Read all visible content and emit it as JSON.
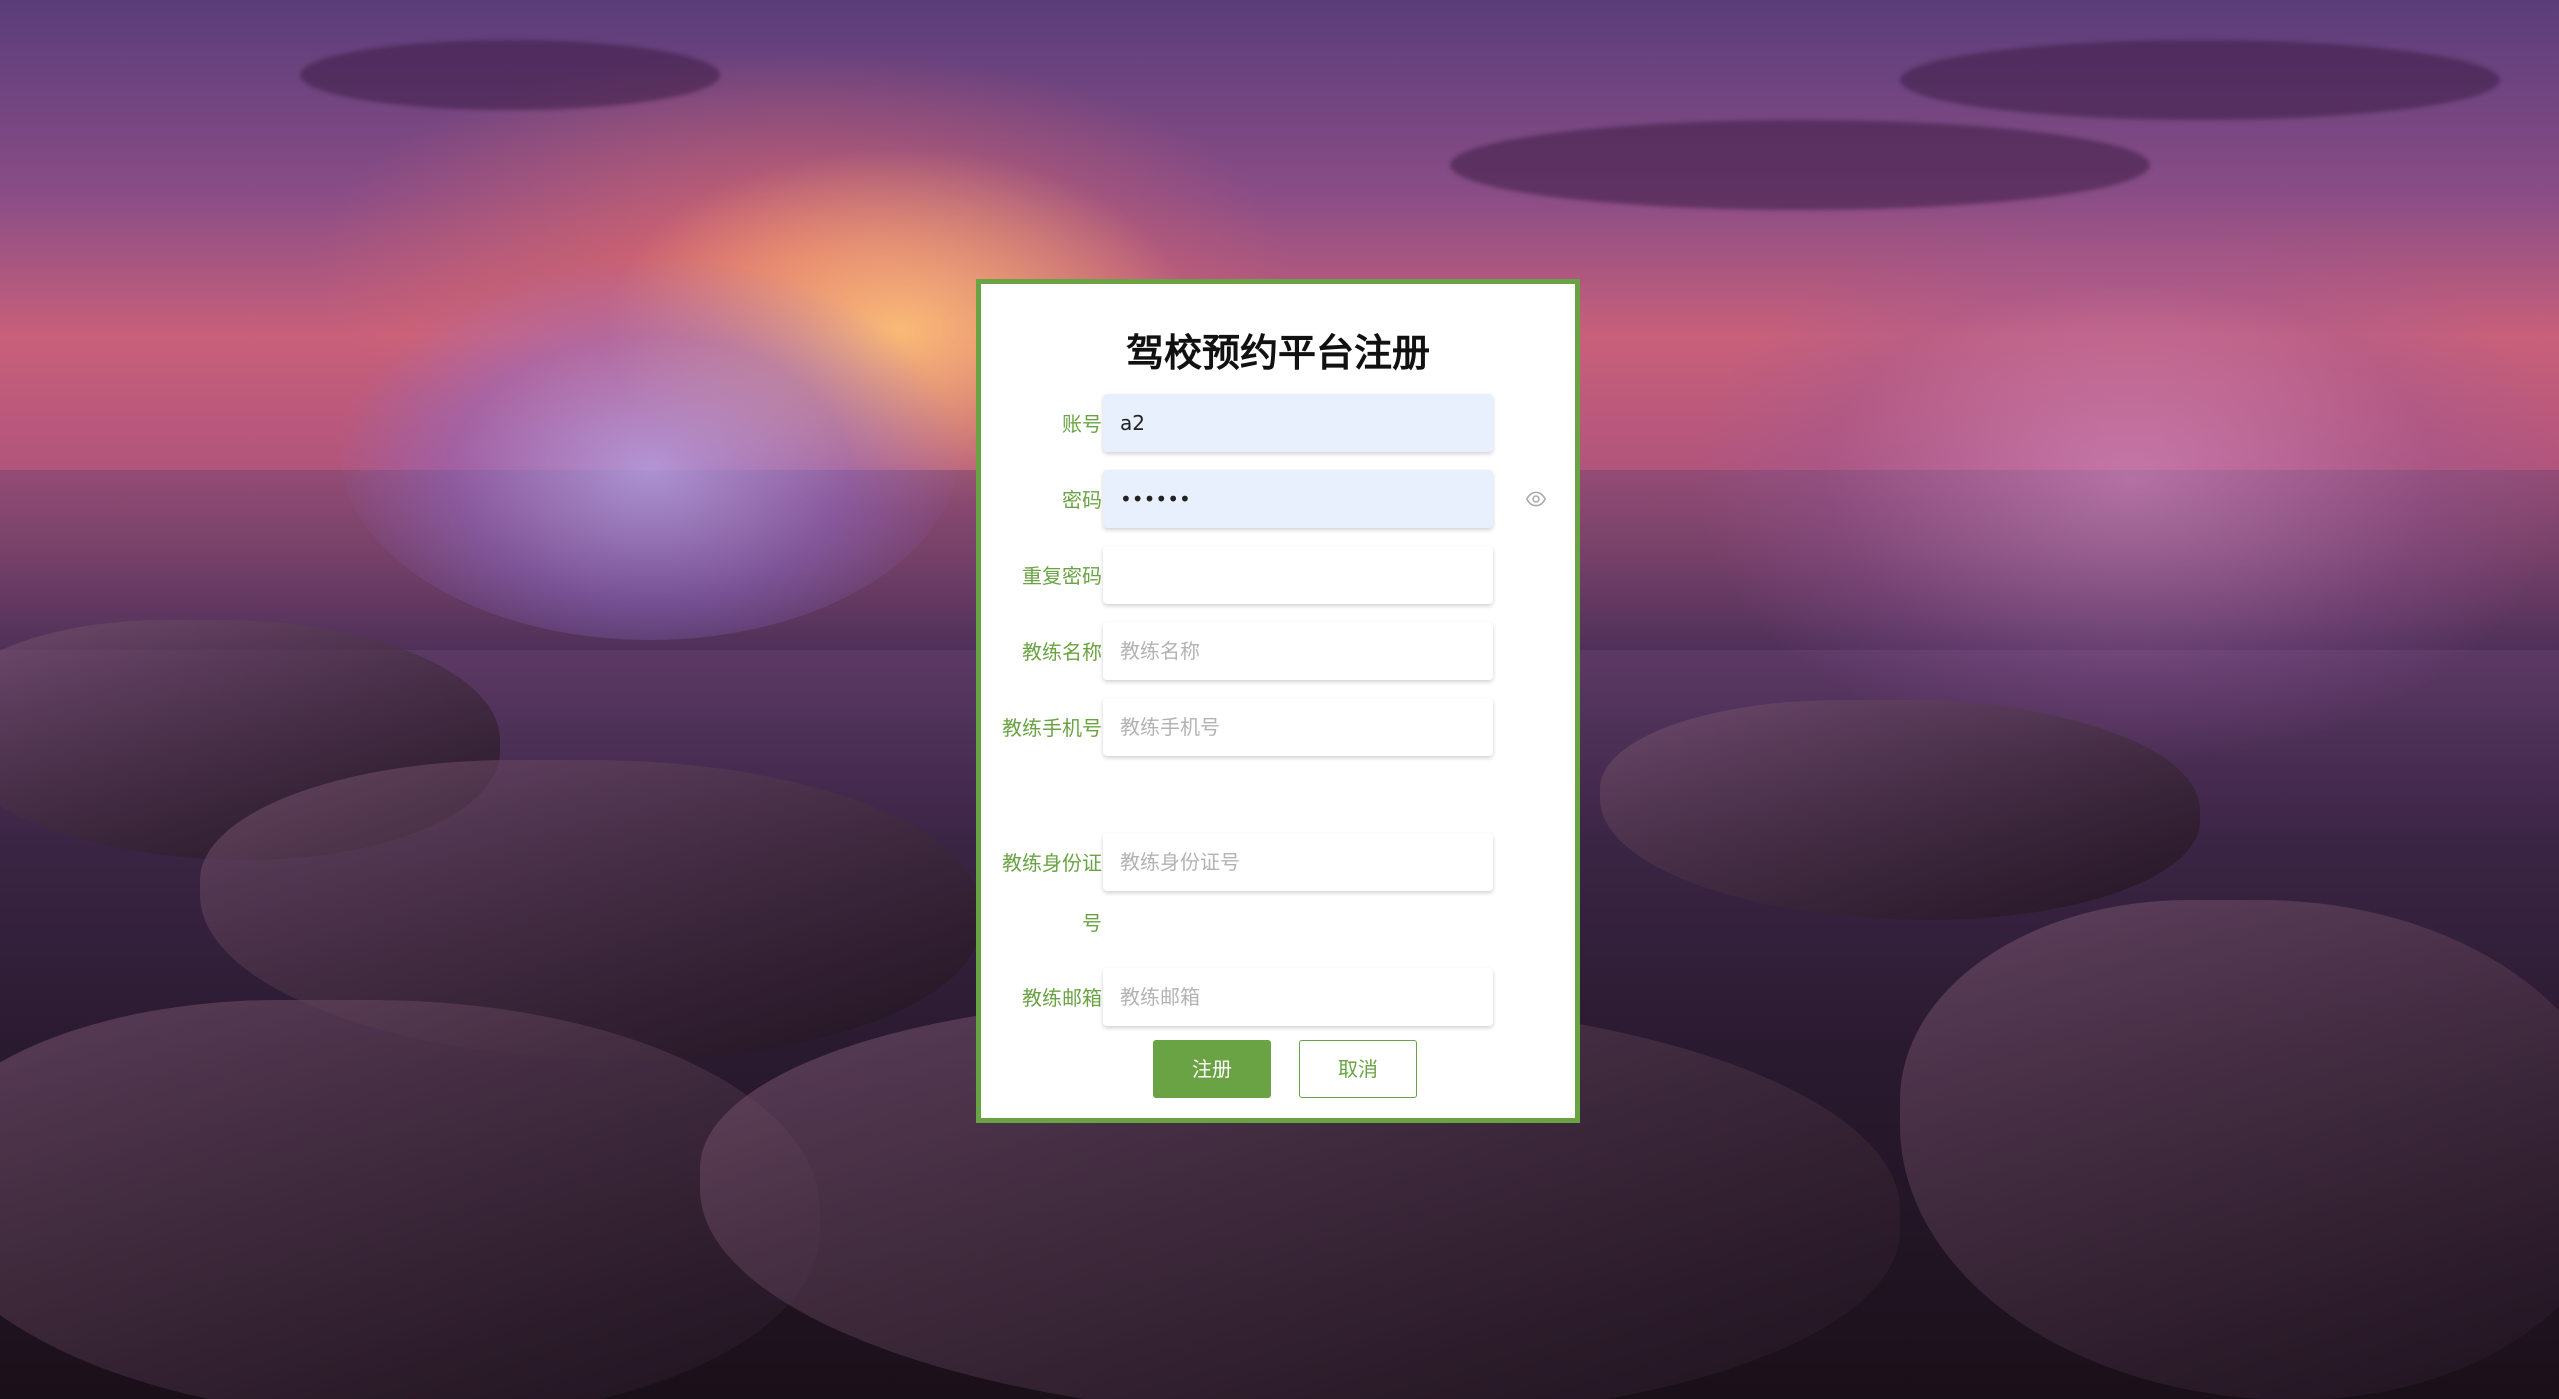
{
  "form": {
    "title": "驾校预约平台注册",
    "fields": [
      {
        "label": "账号",
        "value": "a2",
        "placeholder": ""
      },
      {
        "label": "密码",
        "value": "••••••",
        "placeholder": ""
      },
      {
        "label": "重复密码",
        "value": "",
        "placeholder": ""
      },
      {
        "label": "教练名称",
        "value": "",
        "placeholder": "教练名称"
      },
      {
        "label": "教练手机号",
        "value": "",
        "placeholder": "教练手机号"
      },
      {
        "label": "教练身份证号",
        "value": "",
        "placeholder": "教练身份证号"
      },
      {
        "label": "教练邮箱",
        "value": "",
        "placeholder": "教练邮箱"
      }
    ],
    "submit_label": "注册",
    "cancel_label": "取消",
    "password_toggle_icon": "eye-icon"
  },
  "colors": {
    "accent": "#6aa343",
    "autofill_bg": "#e8f0fe",
    "placeholder": "#b3b3b3"
  }
}
